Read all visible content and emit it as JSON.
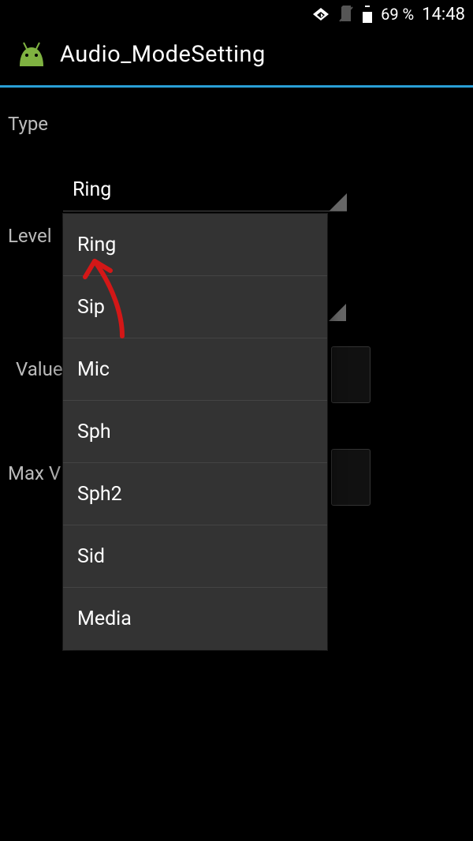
{
  "status_bar": {
    "battery_pct": "69 %",
    "time": "14:48"
  },
  "action_bar": {
    "title": "Audio_ModeSetting"
  },
  "labels": {
    "type": "Type",
    "level": "Level",
    "value": "Value",
    "max": "Max V"
  },
  "spinner_type": {
    "selected": "Ring"
  },
  "dropdown": {
    "items": [
      "Ring",
      "Sip",
      "Mic",
      "Sph",
      "Sph2",
      "Sid",
      "Media"
    ]
  }
}
